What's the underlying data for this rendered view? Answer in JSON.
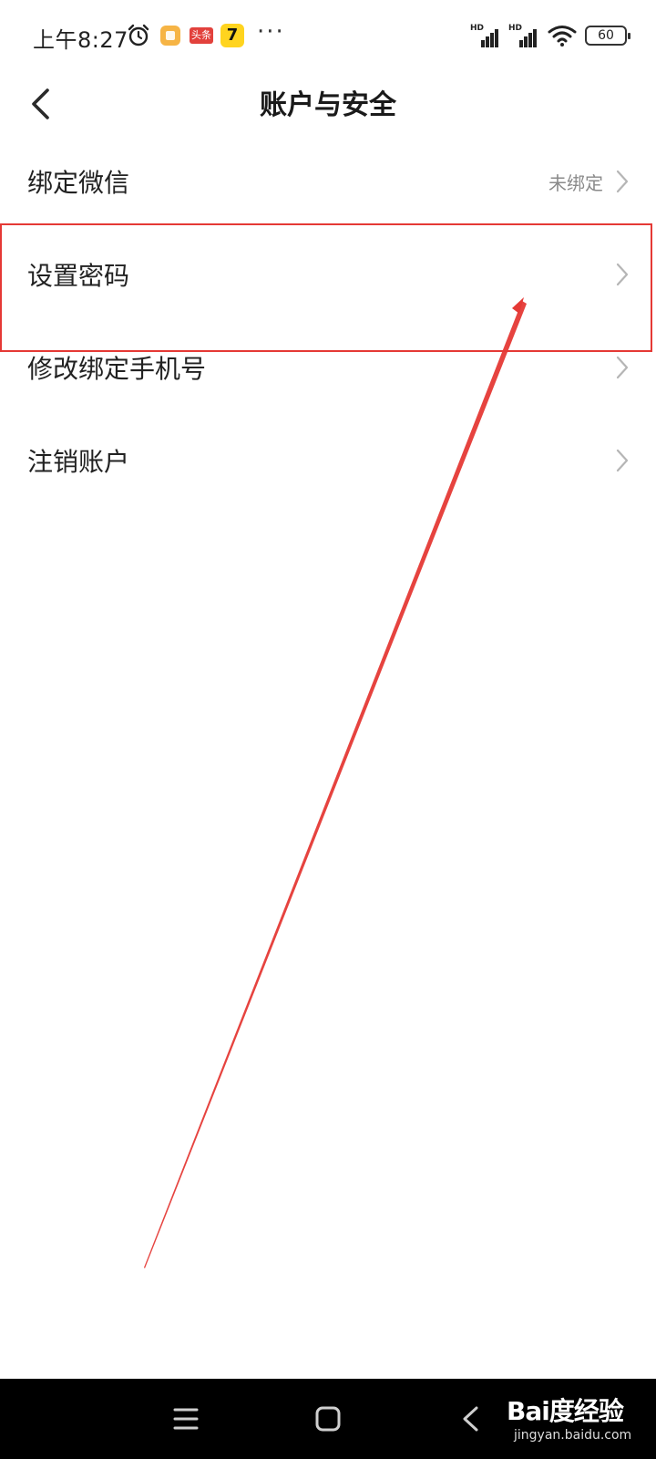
{
  "status_bar": {
    "time": "上午8:27",
    "app2_label": "头条",
    "app3_label": "7",
    "more": "···",
    "signal_label": "HD",
    "signal2_label": "HD",
    "battery": "60"
  },
  "header": {
    "title": "账户与安全",
    "back_icon": "chevron-left-icon"
  },
  "list": {
    "items": [
      {
        "label": "绑定微信",
        "value": "未绑定"
      },
      {
        "label": "设置密码",
        "value": ""
      },
      {
        "label": "修改绑定手机号",
        "value": ""
      },
      {
        "label": "注销账户",
        "value": ""
      }
    ]
  },
  "nav_bar": {
    "icons": [
      "menu-icon",
      "home-square-icon",
      "back-triangle-icon"
    ]
  },
  "watermark": {
    "brand": "Bai度经验",
    "url": "jingyan.baidu.com"
  },
  "colors": {
    "highlight": "#e53935",
    "text_primary": "#222222",
    "text_secondary": "#8a8a8a",
    "chevron": "#b5b5b5",
    "nav_bg": "#000000"
  }
}
